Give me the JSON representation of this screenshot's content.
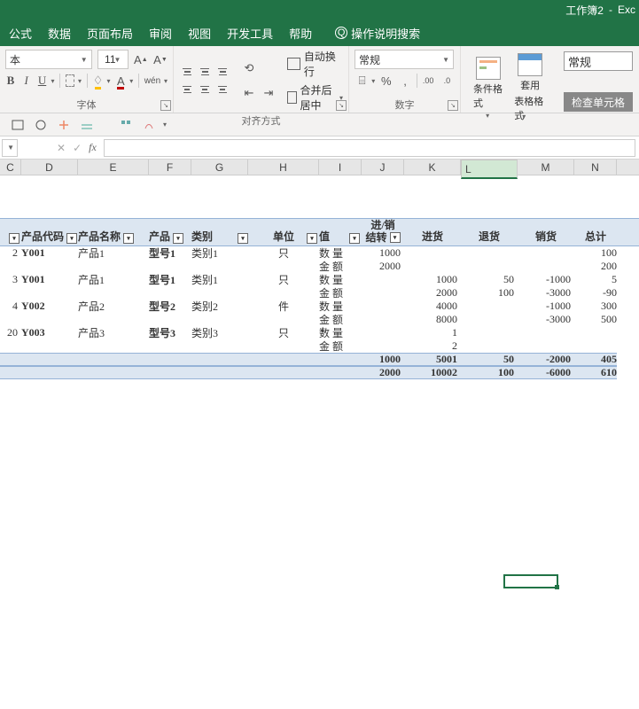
{
  "title": {
    "workbook": "工作簿2",
    "app": "Exc"
  },
  "tabs": [
    "公式",
    "数据",
    "页面布局",
    "审阅",
    "视图",
    "开发工具",
    "帮助"
  ],
  "help_search": "操作说明搜索",
  "ribbon": {
    "font": {
      "name": "本",
      "size": "11",
      "group_label": "字体"
    },
    "align": {
      "wrap": "自动换行",
      "merge": "合并后居中",
      "group_label": "对齐方式"
    },
    "number": {
      "format": "常规",
      "group_label": "数字"
    },
    "styles": {
      "cond": "条件格式",
      "table": "套用",
      "table2": "表格格式"
    },
    "search": {
      "value": "常规",
      "check": "检查单元格"
    }
  },
  "columns": [
    "C",
    "D",
    "E",
    "F",
    "G",
    "H",
    "I",
    "J",
    "K",
    "L",
    "M",
    "N"
  ],
  "table_headers": {
    "code": "产品代码",
    "name": "产品名称",
    "model": "产品",
    "category": "类别",
    "unit": "单位",
    "value": "值",
    "inout_top": "进/销",
    "inout_bot": "结转",
    "buy": "进货",
    "return": "退货",
    "sell": "销货",
    "total": "总计"
  },
  "row_labels": {
    "qty": "数 量",
    "amt": "金 额"
  },
  "chart_data": {
    "type": "table",
    "rows": [
      {
        "idx": 2,
        "code": "Y001",
        "name": "产品1",
        "model": "型号1",
        "cat": "类别1",
        "unit": "只",
        "qty": {
          "carry": 1000,
          "total": 100
        },
        "amt": {
          "carry": 2000,
          "total": 200
        }
      },
      {
        "idx": 3,
        "code": "Y001",
        "name": "产品1",
        "model": "型号1",
        "cat": "类别1",
        "unit": "只",
        "qty": {
          "buy": 1000,
          "ret": 50,
          "sell": -1000,
          "total": 5
        },
        "amt": {
          "buy": 2000,
          "ret": 100,
          "sell": -3000,
          "total": -90
        }
      },
      {
        "idx": 4,
        "code": "Y002",
        "name": "产品2",
        "model": "型号2",
        "cat": "类别2",
        "unit": "件",
        "qty": {
          "buy": 4000,
          "sell": -1000,
          "total": 300
        },
        "amt": {
          "buy": 8000,
          "sell": -3000,
          "total": 500
        }
      },
      {
        "idx": 20,
        "code": "Y003",
        "name": "产品3",
        "model": "型号3",
        "cat": "类别3",
        "unit": "只",
        "qty": {
          "buy": 1
        },
        "amt": {
          "buy": 2
        }
      }
    ],
    "totals": {
      "qty": {
        "carry": 1000,
        "buy": 5001,
        "ret": 50,
        "sell": -2000,
        "total": 405
      },
      "amt": {
        "carry": 2000,
        "buy": 10002,
        "ret": 100,
        "sell": -6000,
        "total": 610
      }
    }
  }
}
